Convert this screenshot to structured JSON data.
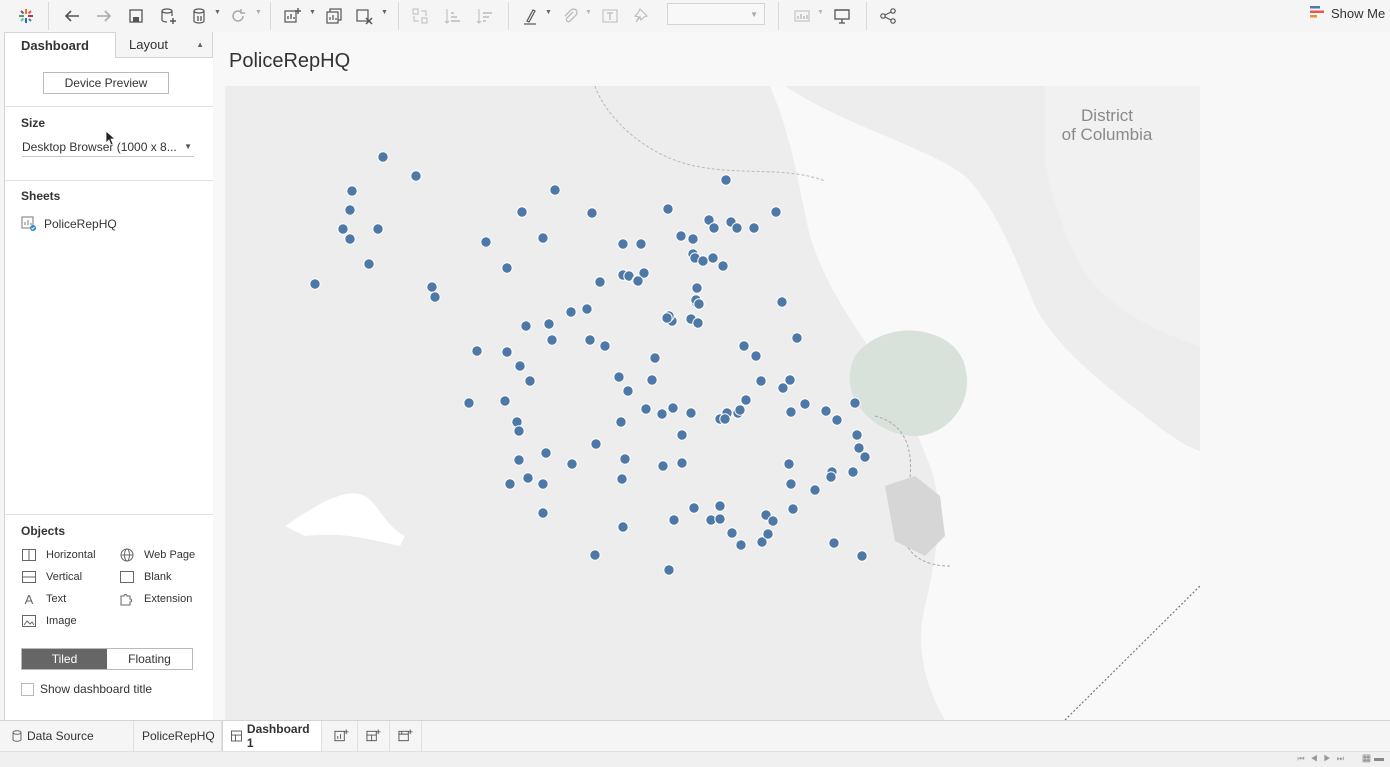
{
  "toolbar": {
    "icons": [
      "tableau-logo-icon",
      "back-icon",
      "forward-icon",
      "save-icon",
      "new-datasource-icon",
      "pause-icon",
      "refresh-icon",
      "new-worksheet-icon",
      "duplicate-icon",
      "clear-icon",
      "swap-icon",
      "sort-asc-icon",
      "sort-desc-icon",
      "highlight-icon",
      "group-icon",
      "label-icon",
      "pin-icon",
      "fit-dropdown",
      "chart-icon",
      "presentation-icon",
      "share-icon"
    ],
    "show_me_label": "Show Me"
  },
  "sidebar": {
    "tabs": [
      {
        "label": "Dashboard"
      },
      {
        "label": "Layout"
      }
    ],
    "device_preview_label": "Device Preview",
    "size_title": "Size",
    "size_value": "Desktop Browser (1000 x 8...",
    "sheets_title": "Sheets",
    "sheets": [
      {
        "label": "PoliceRepHQ"
      }
    ],
    "objects_title": "Objects",
    "objects": [
      {
        "label": "Horizontal",
        "icon": "horizontal-icon"
      },
      {
        "label": "Web Page",
        "icon": "globe-icon"
      },
      {
        "label": "Vertical",
        "icon": "vertical-icon"
      },
      {
        "label": "Blank",
        "icon": "blank-icon"
      },
      {
        "label": "Text",
        "icon": "text-icon"
      },
      {
        "label": "Extension",
        "icon": "extension-icon"
      },
      {
        "label": "Image",
        "icon": "image-icon"
      }
    ],
    "layout_modes": [
      {
        "label": "Tiled",
        "selected": true
      },
      {
        "label": "Floating",
        "selected": false
      }
    ],
    "show_title_label": "Show dashboard title",
    "show_title_checked": false
  },
  "dashboard": {
    "title": "PoliceRepHQ",
    "map_label": "District of Columbia",
    "map_label_lines": [
      "District",
      "of Columbia"
    ],
    "point_color": "#4e79a7",
    "point_count": 130
  },
  "bottom_tabs": [
    {
      "label": "Data Source",
      "icon": "database-icon"
    },
    {
      "label": "PoliceRepHQ",
      "icon": ""
    },
    {
      "label": "Dashboard 1",
      "icon": "dashboard-icon",
      "active": true
    }
  ],
  "bottom_actions": [
    "new-worksheet-icon",
    "new-dashboard-icon",
    "new-story-icon"
  ]
}
